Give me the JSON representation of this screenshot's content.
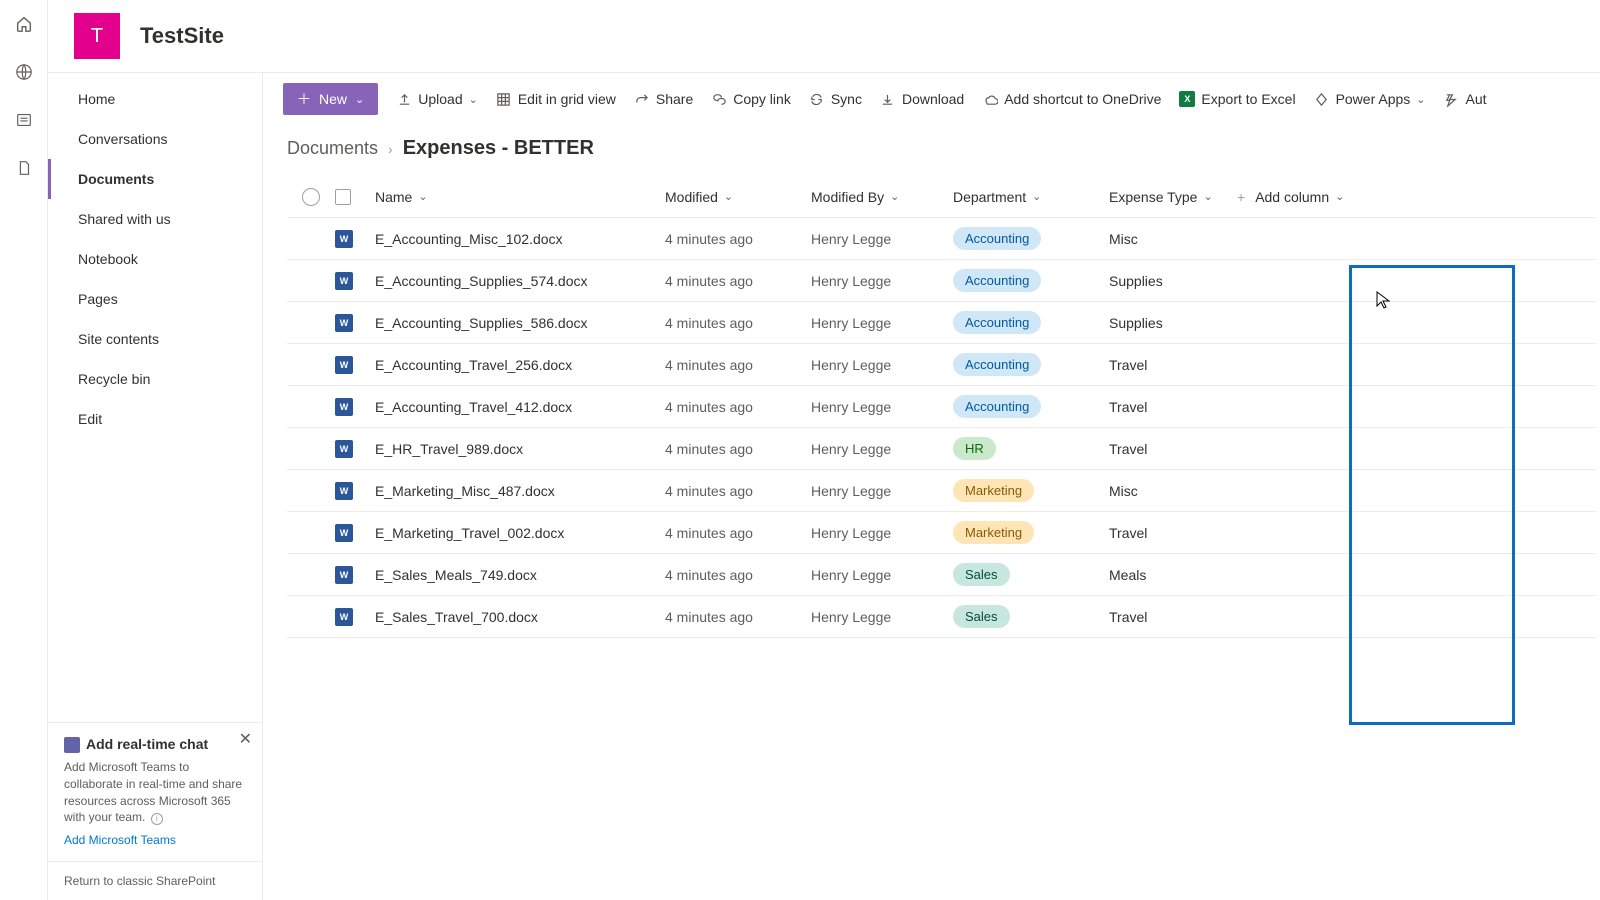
{
  "site": {
    "logo_letter": "T",
    "title": "TestSite"
  },
  "nav": {
    "items": [
      {
        "label": "Home"
      },
      {
        "label": "Conversations"
      },
      {
        "label": "Documents"
      },
      {
        "label": "Shared with us"
      },
      {
        "label": "Notebook"
      },
      {
        "label": "Pages"
      },
      {
        "label": "Site contents"
      },
      {
        "label": "Recycle bin"
      },
      {
        "label": "Edit"
      }
    ],
    "active_index": 2
  },
  "promo": {
    "title": "Add real-time chat",
    "body": "Add Microsoft Teams to collaborate in real-time and share resources across Microsoft 365 with your team.",
    "link": "Add Microsoft Teams"
  },
  "classic_link": "Return to classic SharePoint",
  "toolbar": {
    "new": "New",
    "upload": "Upload",
    "edit_grid": "Edit in grid view",
    "share": "Share",
    "copy_link": "Copy link",
    "sync": "Sync",
    "download": "Download",
    "add_shortcut": "Add shortcut to OneDrive",
    "export_excel": "Export to Excel",
    "power_apps": "Power Apps",
    "automate": "Aut"
  },
  "breadcrumb": {
    "root": "Documents",
    "current": "Expenses - BETTER"
  },
  "columns": {
    "name": "Name",
    "modified": "Modified",
    "modified_by": "Modified By",
    "department": "Department",
    "expense_type": "Expense Type",
    "add_column": "Add column"
  },
  "rows": [
    {
      "name": "E_Accounting_Misc_102.docx",
      "modified": "4 minutes ago",
      "modified_by": "Henry Legge",
      "department": "Accounting",
      "expense_type": "Misc"
    },
    {
      "name": "E_Accounting_Supplies_574.docx",
      "modified": "4 minutes ago",
      "modified_by": "Henry Legge",
      "department": "Accounting",
      "expense_type": "Supplies"
    },
    {
      "name": "E_Accounting_Supplies_586.docx",
      "modified": "4 minutes ago",
      "modified_by": "Henry Legge",
      "department": "Accounting",
      "expense_type": "Supplies"
    },
    {
      "name": "E_Accounting_Travel_256.docx",
      "modified": "4 minutes ago",
      "modified_by": "Henry Legge",
      "department": "Accounting",
      "expense_type": "Travel"
    },
    {
      "name": "E_Accounting_Travel_412.docx",
      "modified": "4 minutes ago",
      "modified_by": "Henry Legge",
      "department": "Accounting",
      "expense_type": "Travel"
    },
    {
      "name": "E_HR_Travel_989.docx",
      "modified": "4 minutes ago",
      "modified_by": "Henry Legge",
      "department": "HR",
      "expense_type": "Travel"
    },
    {
      "name": "E_Marketing_Misc_487.docx",
      "modified": "4 minutes ago",
      "modified_by": "Henry Legge",
      "department": "Marketing",
      "expense_type": "Misc"
    },
    {
      "name": "E_Marketing_Travel_002.docx",
      "modified": "4 minutes ago",
      "modified_by": "Henry Legge",
      "department": "Marketing",
      "expense_type": "Travel"
    },
    {
      "name": "E_Sales_Meals_749.docx",
      "modified": "4 minutes ago",
      "modified_by": "Henry Legge",
      "department": "Sales",
      "expense_type": "Meals"
    },
    {
      "name": "E_Sales_Travel_700.docx",
      "modified": "4 minutes ago",
      "modified_by": "Henry Legge",
      "department": "Sales",
      "expense_type": "Travel"
    }
  ]
}
